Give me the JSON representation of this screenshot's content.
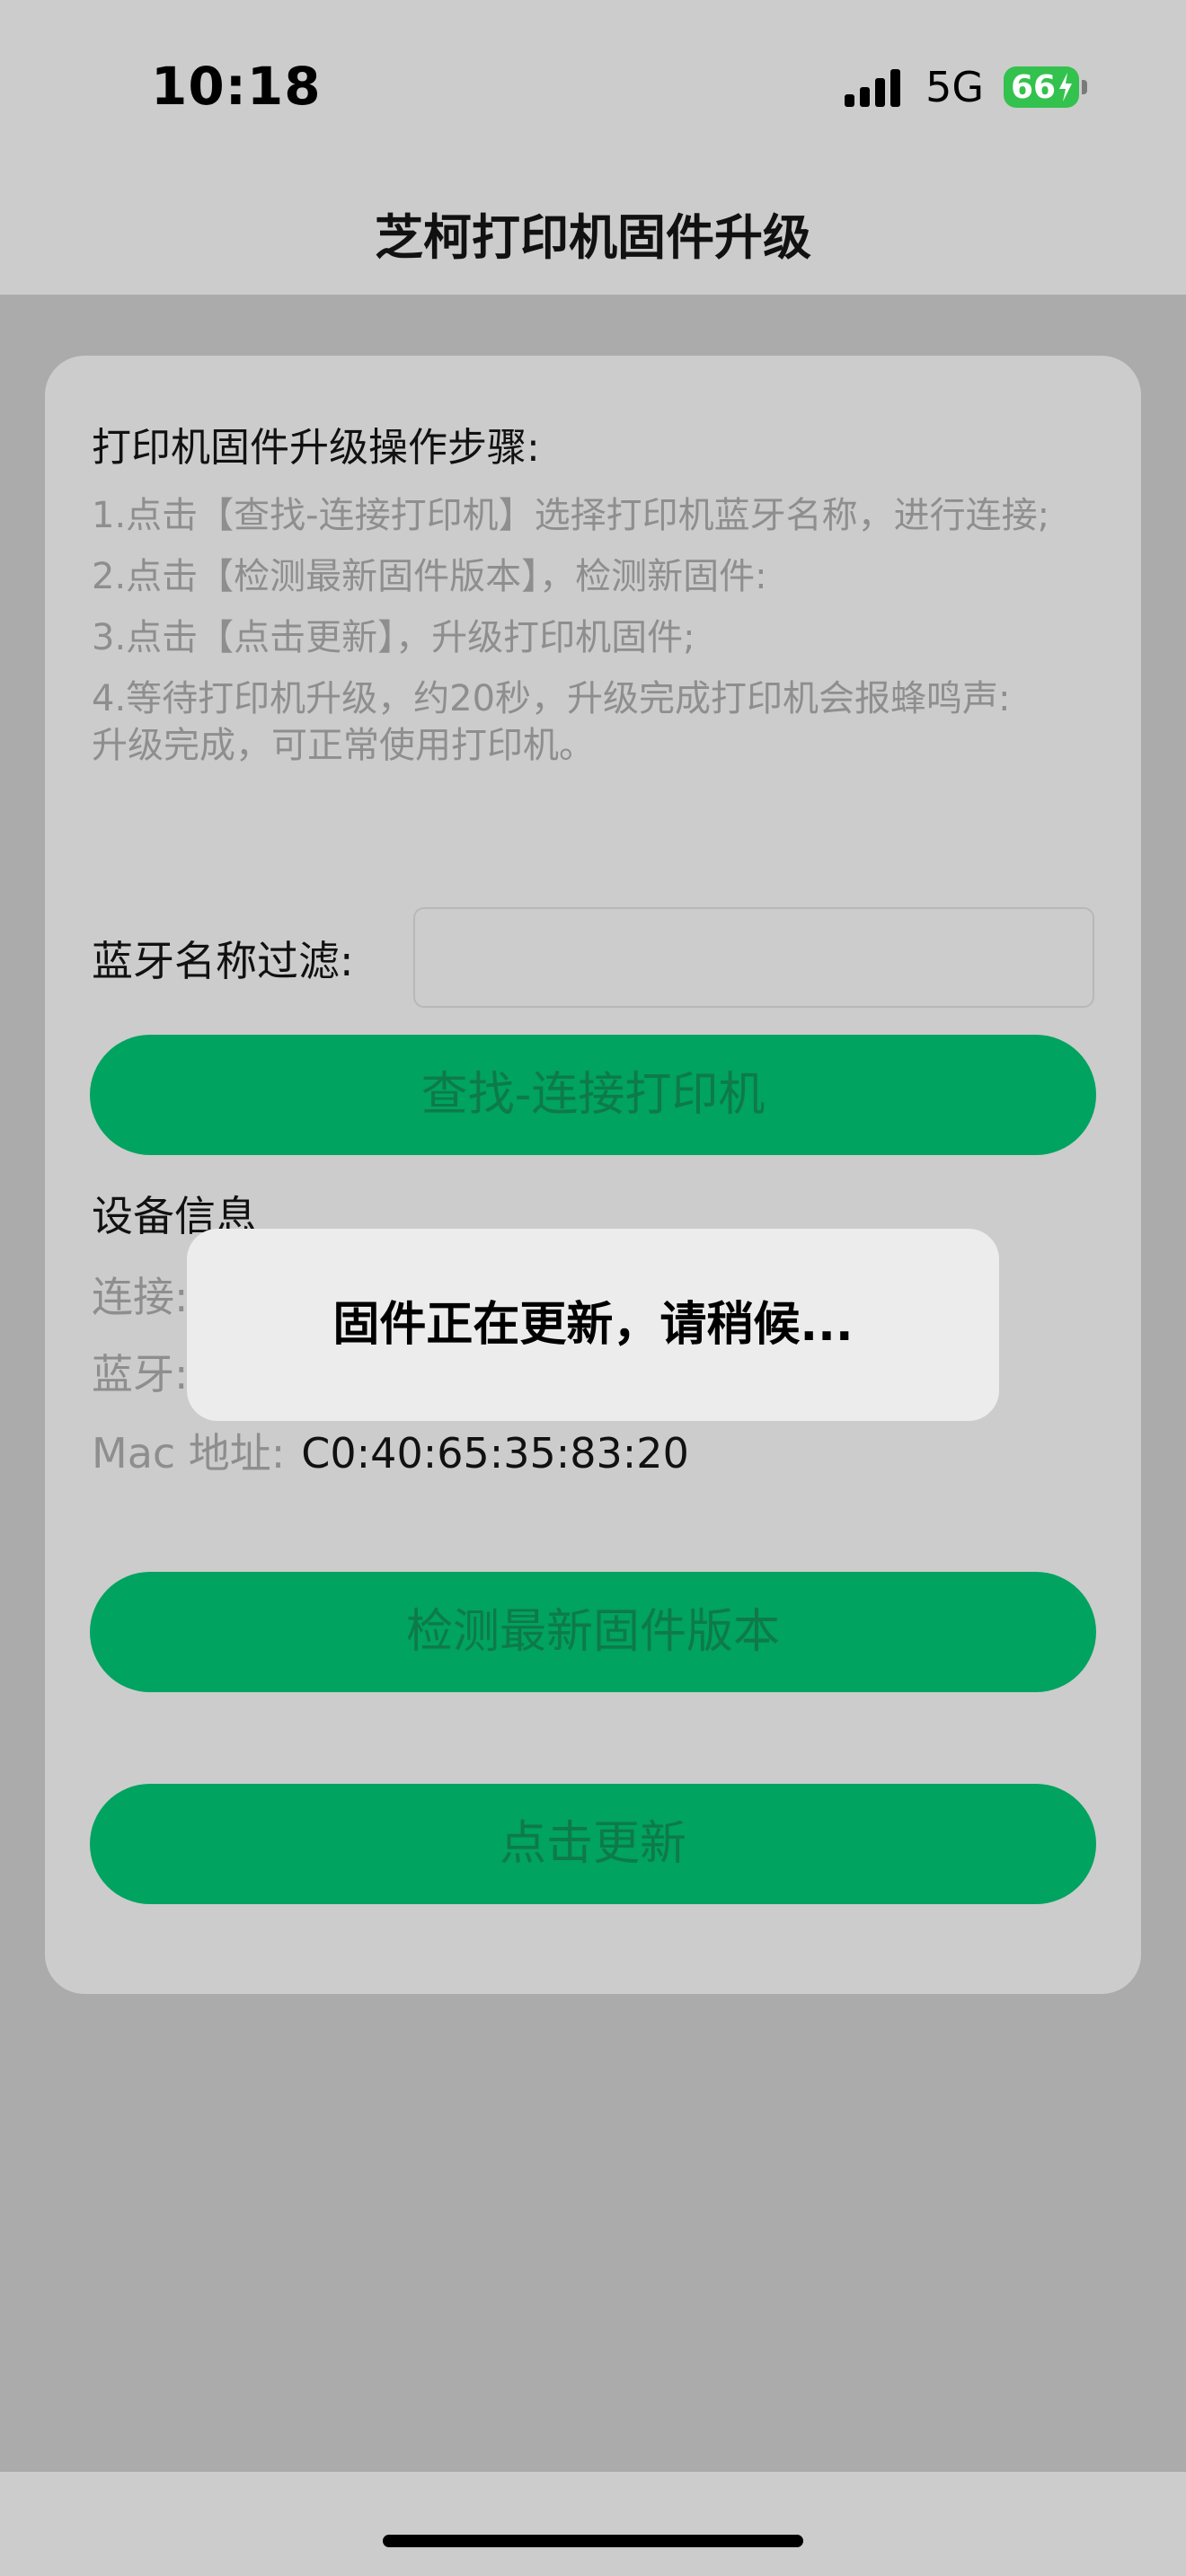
{
  "status_bar": {
    "time": "10:18",
    "network": "5G",
    "battery": "66",
    "battery_color": "#33c24d"
  },
  "nav": {
    "title": "芝柯打印机固件升级"
  },
  "instructions": {
    "title": "打印机固件升级操作步骤:",
    "steps": [
      "1.点击【查找-连接打印机】选择打印机蓝牙名称，进行连接;",
      "2.点击【检测最新固件版本】，检测新固件:",
      "3.点击【点击更新】，升级打印机固件;",
      "4.等待打印机升级，约20秒，升级完成打印机会报蜂鸣声:",
      "升级完成，可正常使用打印机。"
    ]
  },
  "filter": {
    "label": "蓝牙名称过滤:",
    "value": "",
    "placeholder": ""
  },
  "buttons": {
    "connect": "查找-连接打印机",
    "check_version": "检测最新固件版本",
    "update": "点击更新",
    "color": "#00a35f"
  },
  "device_info": {
    "title": "设备信息",
    "connection_label": "连接:",
    "bluetooth_label": "蓝牙:",
    "mac_label": "Mac 地址:",
    "mac_value": "C0:40:65:35:83:20"
  },
  "toast": {
    "message": "固件正在更新，请稍候..."
  }
}
